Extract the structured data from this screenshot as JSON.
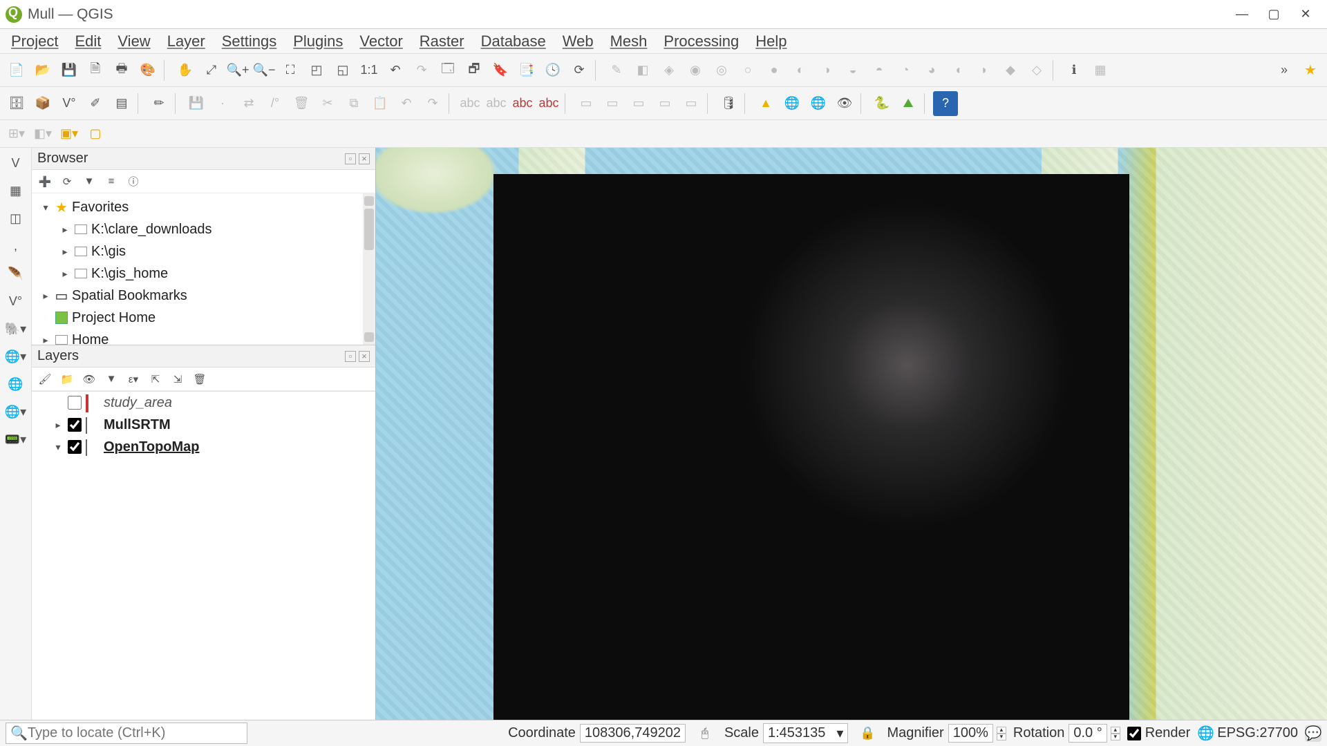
{
  "window": {
    "title": "Mull — QGIS"
  },
  "menu": [
    "Project",
    "Edit",
    "View",
    "Layer",
    "Settings",
    "Plugins",
    "Vector",
    "Raster",
    "Database",
    "Web",
    "Mesh",
    "Processing",
    "Help"
  ],
  "browser_panel": {
    "title": "Browser",
    "items": [
      {
        "label": "Favorites",
        "indent": 0,
        "expander": "▾",
        "icon": "star"
      },
      {
        "label": "K:\\clare_downloads",
        "indent": 1,
        "expander": "▸",
        "icon": "folder"
      },
      {
        "label": "K:\\gis",
        "indent": 1,
        "expander": "▸",
        "icon": "folder"
      },
      {
        "label": "K:\\gis_home",
        "indent": 1,
        "expander": "▸",
        "icon": "folder"
      },
      {
        "label": "Spatial Bookmarks",
        "indent": 0,
        "expander": "▸",
        "icon": "bookmark"
      },
      {
        "label": "Project Home",
        "indent": 0,
        "expander": "",
        "icon": "home"
      },
      {
        "label": "Home",
        "indent": 0,
        "expander": "▸",
        "icon": "folder"
      }
    ]
  },
  "layers_panel": {
    "title": "Layers",
    "items": [
      {
        "name": "study_area",
        "checked": false,
        "expander": "",
        "style": "italic",
        "icon": "poly"
      },
      {
        "name": "MullSRTM",
        "checked": true,
        "expander": "▸",
        "style": "bold",
        "icon": "raster"
      },
      {
        "name": "OpenTopoMap",
        "checked": true,
        "expander": "▾",
        "style": "underline",
        "icon": "raster"
      }
    ]
  },
  "status": {
    "locator_placeholder": "Type to locate (Ctrl+K)",
    "coord_label": "Coordinate",
    "coord_value": "108306,749202",
    "scale_label": "Scale",
    "scale_value": "1:453135",
    "mag_label": "Magnifier",
    "mag_value": "100%",
    "rot_label": "Rotation",
    "rot_value": "0.0 °",
    "render_label": "Render",
    "crs": "EPSG:27700"
  }
}
